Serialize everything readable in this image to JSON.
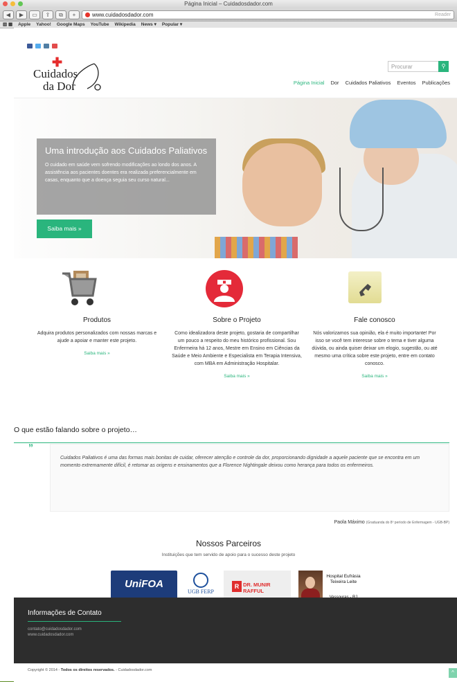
{
  "browser": {
    "window_title": "Página Inicial – Cuidadosdador.com",
    "url": "www.cuidadosdador.com",
    "reader": "Reader",
    "bookmarks": [
      "Apple",
      "Yahoo!",
      "Google Maps",
      "YouTube",
      "Wikipedia",
      "News ▾",
      "Popular ▾"
    ]
  },
  "logo": {
    "line1": "Cuidados",
    "line2": "da Dor"
  },
  "search": {
    "placeholder": "Procurar"
  },
  "nav": [
    "Página Inicial",
    "Dor",
    "Cuidados Paliativos",
    "Eventos",
    "Publicações"
  ],
  "hero": {
    "title": "Uma introdução aos Cuidados Paliativos",
    "text": "O cuidado em saúde vem sofrendo modificações ao londo dos anos. A assistência aos pacientes doentes era realizada preferencialmente em casas, enquanto que a doença seguia seu curso natural...",
    "button": "Saiba mais »"
  },
  "features": [
    {
      "title": "Produtos",
      "text": "Adquira produtos personalizados com nossas marcas e ajude a apoiar e manter este projeto.",
      "link": "Saiba mais »"
    },
    {
      "title": "Sobre o Projeto",
      "text": "Como idealizadora deste projeto, gostaria de compartilhar um pouco a respeito do meu histórico profissional. Sou Enfermeira há 12 anos, Mestre em Ensino em Ciências da Saúde e Meio Ambiente e Especialista em Terapia Intensiva, com MBA em Administração Hospitalar.",
      "link": "Saiba mais »"
    },
    {
      "title": "Fale conosco",
      "text": "Nós valorizamos sua opinião, ela é muito importante! Por isso se você tem interesse sobre o tema e tiver alguma dúvida, ou ainda quiser deixar um elogio, sugestão, ou até mesmo uma crítica sobre este projeto, entre em contato conosco.",
      "link": "Saiba mais »"
    }
  ],
  "testimonials": {
    "title": "O que estão falando sobre o projeto…",
    "quote": "Cuidados Paliativos é uma das formas mais bonitas de cuidar, oferecer atenção  e controle da dor, proporcionando dignidade a aquele paciente que se encontra em um momento extremamente difícil, é retomar as origens e ensinamentos  que a Florence Nightingale deixou como herança para todos os enfermeiros.",
    "author": "Paola Máximo",
    "author_note": "(Graduanda do 8º período de Enfermagem - UGB-BP)"
  },
  "partners": {
    "title": "Nossos Parceiros",
    "subtitle": "Instituições que tem servido de apoio para o sucesso deste projeto",
    "unifoa": "UniFOA",
    "ugb": "UGB FERP",
    "munir": "DR. MUNIR RAFFUL",
    "hospital_name": "Hospital Eufrásia Teixeira Leite",
    "hospital_city": "Vassouras - RJ"
  },
  "footer": {
    "title": "Informações de Contato",
    "email": "contato@cuidadosdador.com",
    "site": "www.cuidadosdador.com",
    "copy_prefix": "Copyright © 2014 - ",
    "copy_bold": "Todos os direitos reservados.",
    "copy_suffix": " - Cuidadosdador.com"
  },
  "colors": {
    "accent": "#2ab57d",
    "footer": "#2d2d2d",
    "red": "#e42a39"
  }
}
